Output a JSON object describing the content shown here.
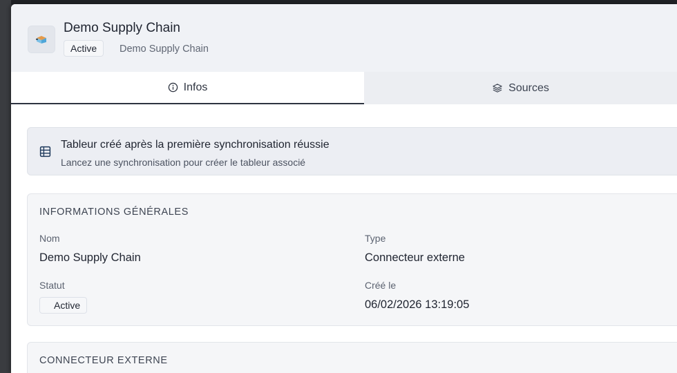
{
  "header": {
    "title": "Demo Supply Chain",
    "status_badge": "Active",
    "subtitle": "Demo Supply Chain",
    "icon": "connector-icon"
  },
  "tabs": [
    {
      "label": "Infos",
      "icon": "info-icon",
      "active": true
    },
    {
      "label": "Sources",
      "icon": "layers-icon",
      "active": false
    }
  ],
  "notice": {
    "icon": "table-icon",
    "title": "Tableur créé après la première synchronisation réussie",
    "message": "Lancez une synchronisation pour créer le tableur associé"
  },
  "general": {
    "section_title": "INFORMATIONS GÉNÉRALES",
    "name_label": "Nom",
    "name_value": "Demo Supply Chain",
    "type_label": "Type",
    "type_value": "Connecteur externe",
    "status_label": "Statut",
    "status_value": "Active",
    "created_label": "Créé le",
    "created_value": "06/02/2026 13:19:05"
  },
  "connector": {
    "section_title": "CONNECTEUR EXTERNE"
  },
  "colors": {
    "panel_background": "#ffffff",
    "header_background": "#f0f2f6",
    "active_tab_border": "#2e3440",
    "card_background": "#f5f6f8"
  }
}
